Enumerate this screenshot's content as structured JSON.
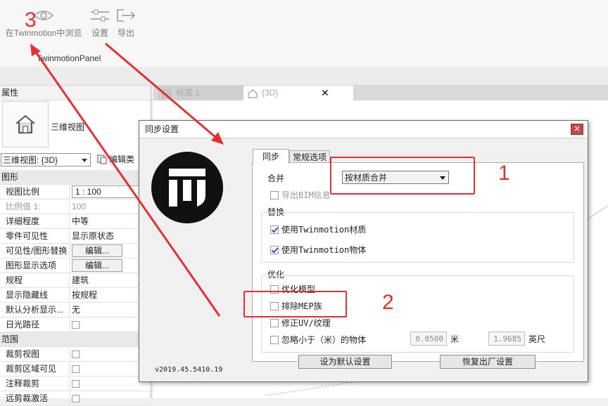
{
  "ribbon": {
    "buttons": [
      {
        "label": "在Twinmotion中浏览",
        "icon": "eye-icon"
      },
      {
        "label": "设置",
        "icon": "sliders-icon"
      },
      {
        "label": "导出",
        "icon": "export-icon"
      }
    ],
    "panel_title": "TwinmotionPanel"
  },
  "annotations": {
    "step1": "1",
    "step2": "2",
    "step3": "3"
  },
  "properties": {
    "header": "属性",
    "type_name": "三维视图",
    "type_select": "三维视图: {3D}",
    "edit_type": "编辑类",
    "rows": [
      {
        "kind": "group",
        "key": "图形"
      },
      {
        "kind": "text",
        "key": "视图比例",
        "value": "1 : 100",
        "style": "box"
      },
      {
        "kind": "text",
        "key": "比例值 1:",
        "value": "100",
        "style": "dim"
      },
      {
        "kind": "text",
        "key": "详细程度",
        "value": "中等"
      },
      {
        "kind": "text",
        "key": "零件可见性",
        "value": "显示原状态"
      },
      {
        "kind": "button",
        "key": "可见性/图形替换",
        "value": "编辑..."
      },
      {
        "kind": "button",
        "key": "图形显示选项",
        "value": "编辑..."
      },
      {
        "kind": "text",
        "key": "规程",
        "value": "建筑"
      },
      {
        "kind": "text",
        "key": "显示隐藏线",
        "value": "按规程"
      },
      {
        "kind": "text",
        "key": "默认分析显示...",
        "value": "无"
      },
      {
        "kind": "check",
        "key": "日光路径",
        "value": ""
      },
      {
        "kind": "group",
        "key": "范围"
      },
      {
        "kind": "check",
        "key": "裁剪视图",
        "value": ""
      },
      {
        "kind": "check",
        "key": "裁剪区域可见",
        "value": ""
      },
      {
        "kind": "check",
        "key": "注释裁剪",
        "value": ""
      },
      {
        "kind": "check",
        "key": "远剪裁激活",
        "value": ""
      }
    ]
  },
  "view_tabs": [
    {
      "label": "标高 1",
      "icon": "floorplan-icon"
    },
    {
      "label": "{3D}",
      "icon": "house-icon"
    }
  ],
  "dialog": {
    "title": "同步设置",
    "version": "v2019.45.5410.19",
    "tabs": {
      "sync": "同步",
      "general": "常规选项"
    },
    "merge_label": "合并",
    "merge_value": "按材质合并",
    "export_bim": "导出BIM信息",
    "replace_label": "替换",
    "use_materials": "使用Twinmotion材质",
    "use_objects": "使用Twinmotion物体",
    "optimize_label": "优化",
    "optimize_model": "优化模型",
    "exclude_mep": "排除MEP族",
    "fix_uv": "修正UV/纹理",
    "ignore_small": "忽略小于（米）的物体",
    "meters_value": "0.0500",
    "meters_unit": "米",
    "feet_value": "1.9685",
    "feet_unit": "英尺",
    "set_default": "设为默认设置",
    "restore_factory": "恢复出厂设置"
  },
  "colors": {
    "annotation_red": "#e43030",
    "logo_black": "#111111"
  }
}
